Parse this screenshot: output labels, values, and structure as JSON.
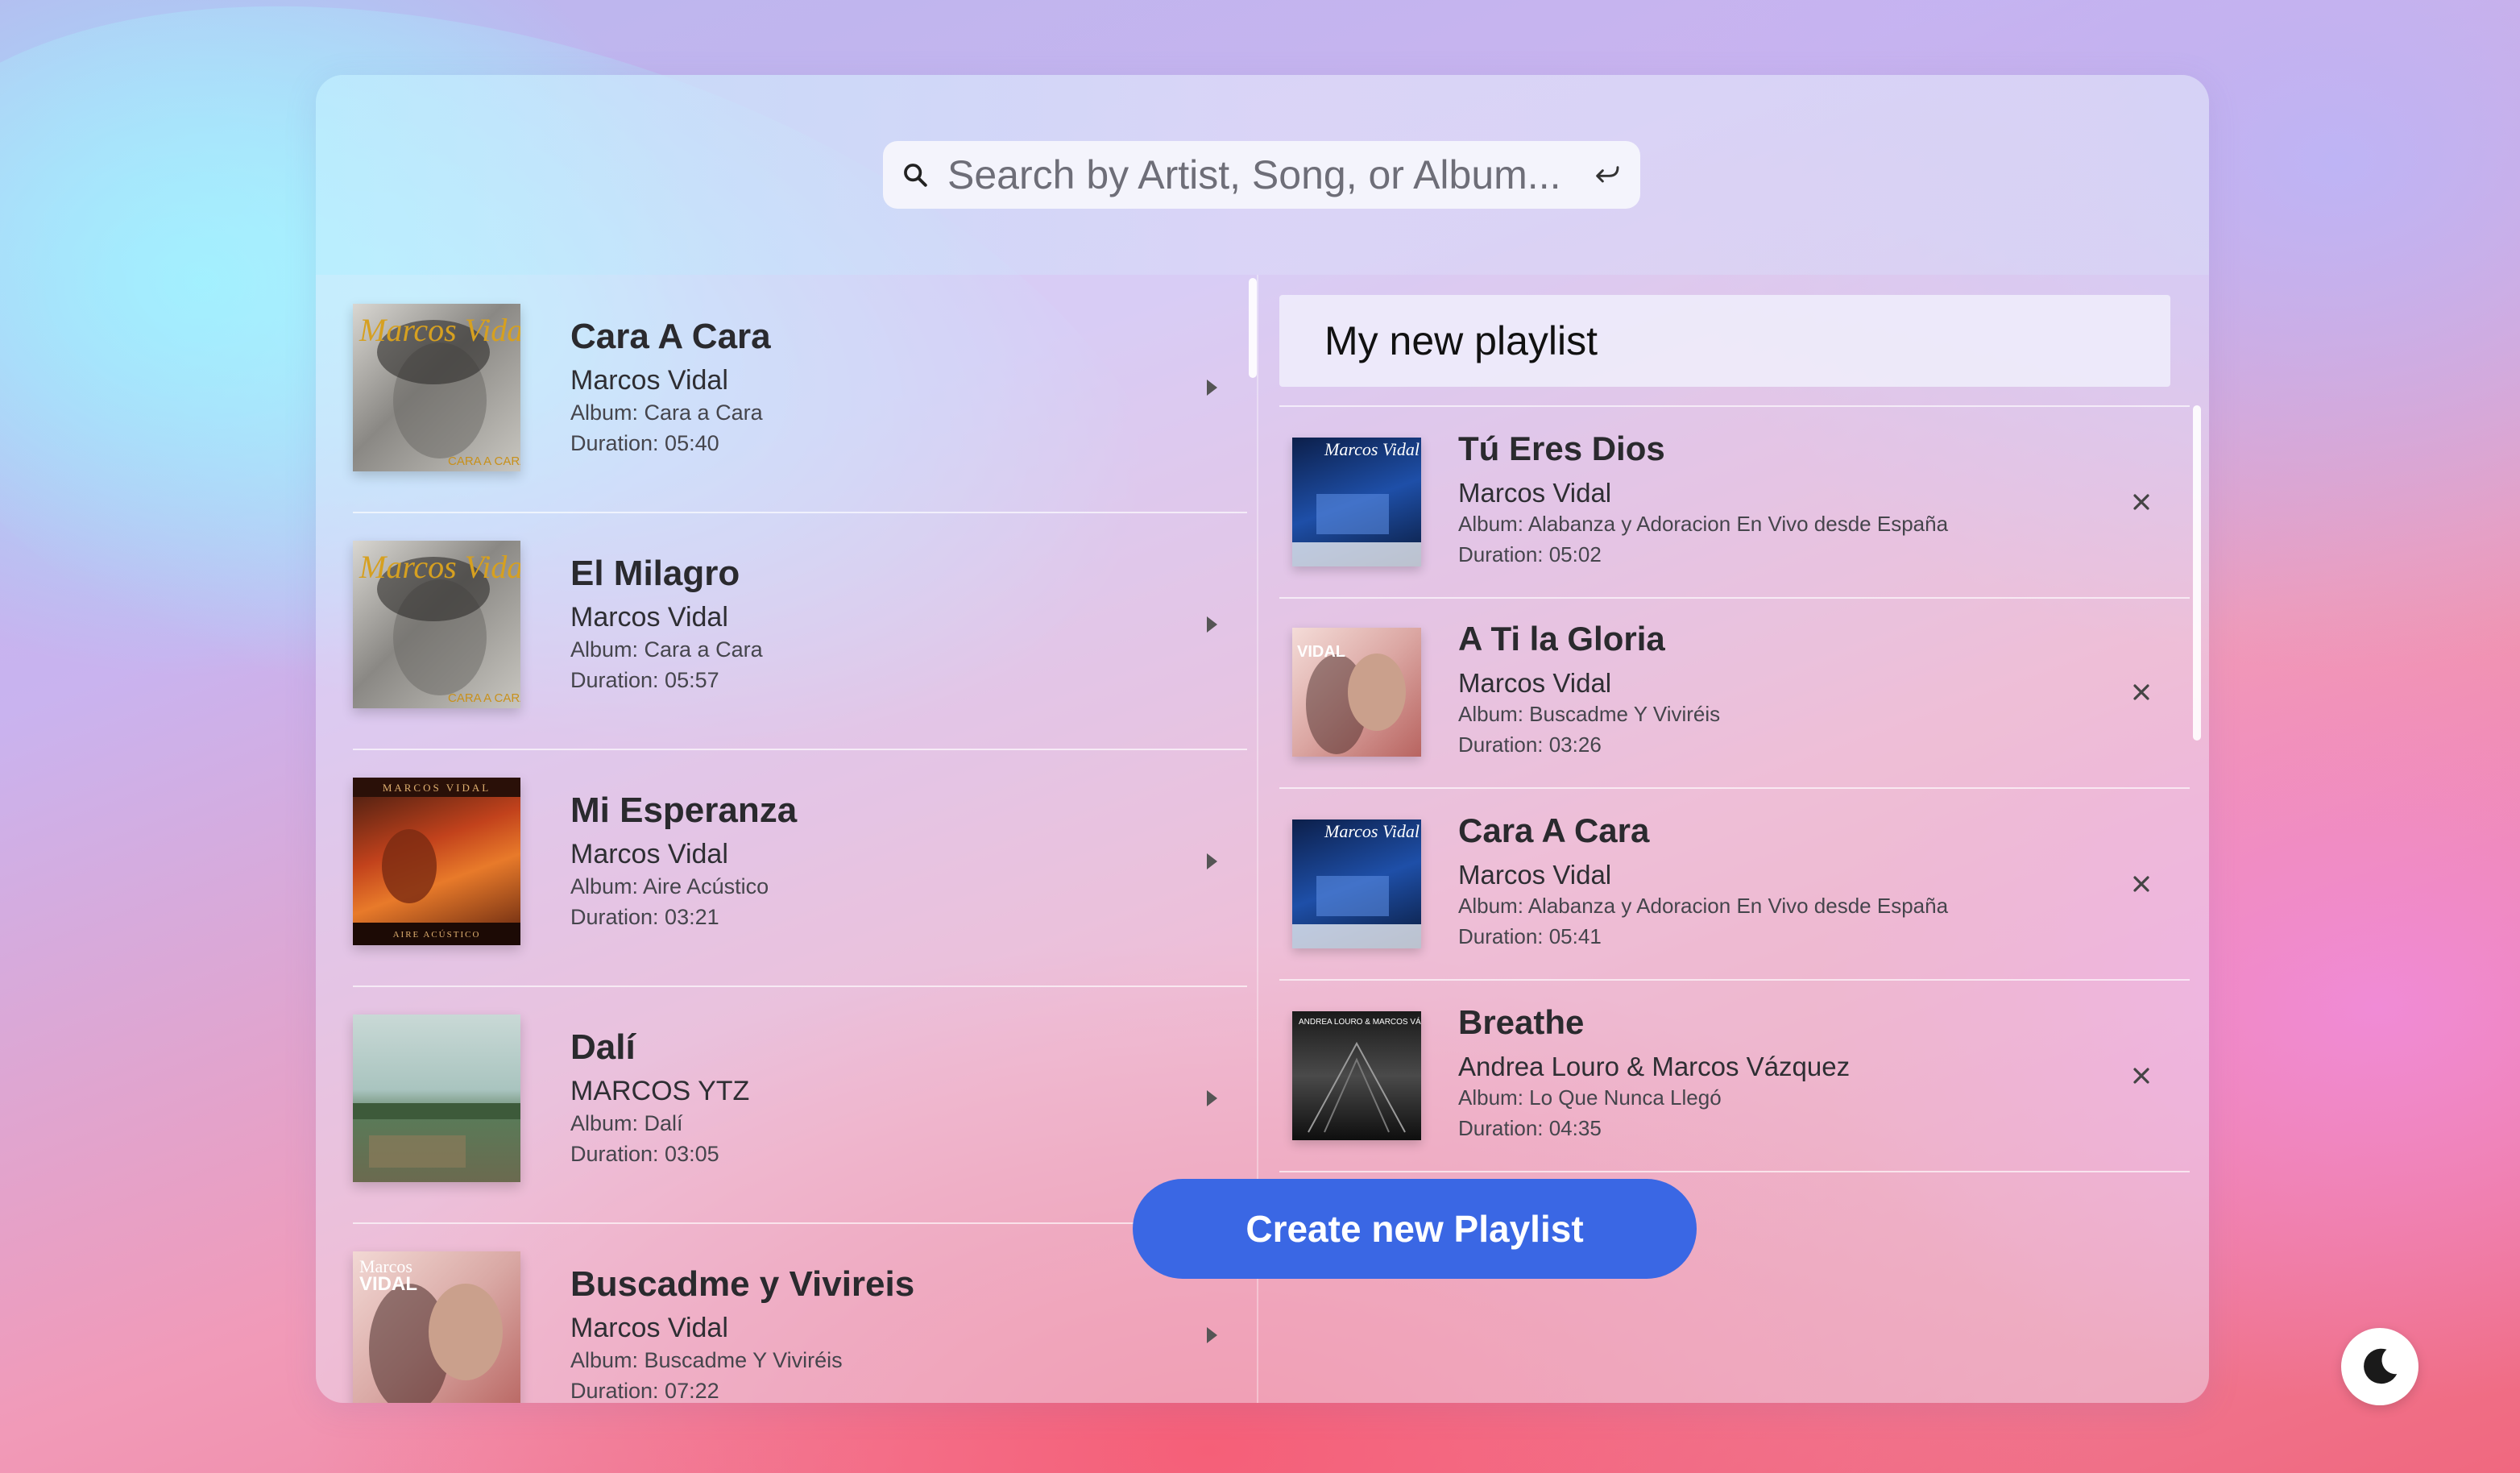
{
  "search": {
    "placeholder": "Search by Artist, Song, or Album..."
  },
  "results": [
    {
      "title": "Cara A Cara",
      "artist": "Marcos Vidal",
      "album": "Album: Cara a Cara",
      "duration": "Duration: 05:40",
      "cover_text": "Marcos Vidal",
      "cover_sub": "CARA A CARA"
    },
    {
      "title": "El Milagro",
      "artist": "Marcos Vidal",
      "album": "Album: Cara a Cara",
      "duration": "Duration: 05:57",
      "cover_text": "Marcos Vidal",
      "cover_sub": "CARA A CARA"
    },
    {
      "title": "Mi Esperanza",
      "artist": "Marcos Vidal",
      "album": "Album: Aire Acústico",
      "duration": "Duration: 03:21",
      "cover_text": "MARCOS VIDAL",
      "cover_sub": "AIRE ACÚSTICO"
    },
    {
      "title": "Dalí",
      "artist": "MARCOS YTZ",
      "album": "Album: Dalí",
      "duration": "Duration: 03:05",
      "cover_text": "",
      "cover_sub": ""
    },
    {
      "title": "Buscadme y Vivireis",
      "artist": "Marcos Vidal",
      "album": "Album: Buscadme Y Viviréis",
      "duration": "Duration: 07:22",
      "cover_text": "Marcos",
      "cover_sub": "VIDAL"
    }
  ],
  "playlist": {
    "name": "My new playlist",
    "items": [
      {
        "title": "Tú Eres Dios",
        "artist": "Marcos Vidal",
        "album": "Album: Alabanza y Adoracion En Vivo desde España",
        "duration": "Duration: 05:02",
        "cover_text": "Marcos Vidal"
      },
      {
        "title": "A Ti la Gloria",
        "artist": "Marcos Vidal",
        "album": "Album: Buscadme Y Viviréis",
        "duration": "Duration: 03:26",
        "cover_text": "VIDAL"
      },
      {
        "title": "Cara A Cara",
        "artist": "Marcos Vidal",
        "album": "Album: Alabanza y Adoracion En Vivo desde España",
        "duration": "Duration: 05:41",
        "cover_text": "Marcos Vidal"
      },
      {
        "title": "Breathe",
        "artist": "Andrea Louro & Marcos Vázquez",
        "album": "Album: Lo Que Nunca Llegó",
        "duration": "Duration: 04:35",
        "cover_text": "ANDREA LOURO & MARCOS VÁZQUEZ"
      }
    ]
  },
  "create_button": {
    "label": "Create new Playlist"
  },
  "icons": {
    "search": "search-icon",
    "enter": "enter-icon",
    "chevron": "chevron-right-icon",
    "remove": "close-icon",
    "theme": "moon-icon"
  },
  "colors": {
    "accent": "#3a67e4",
    "text": "#2a2a2e"
  }
}
